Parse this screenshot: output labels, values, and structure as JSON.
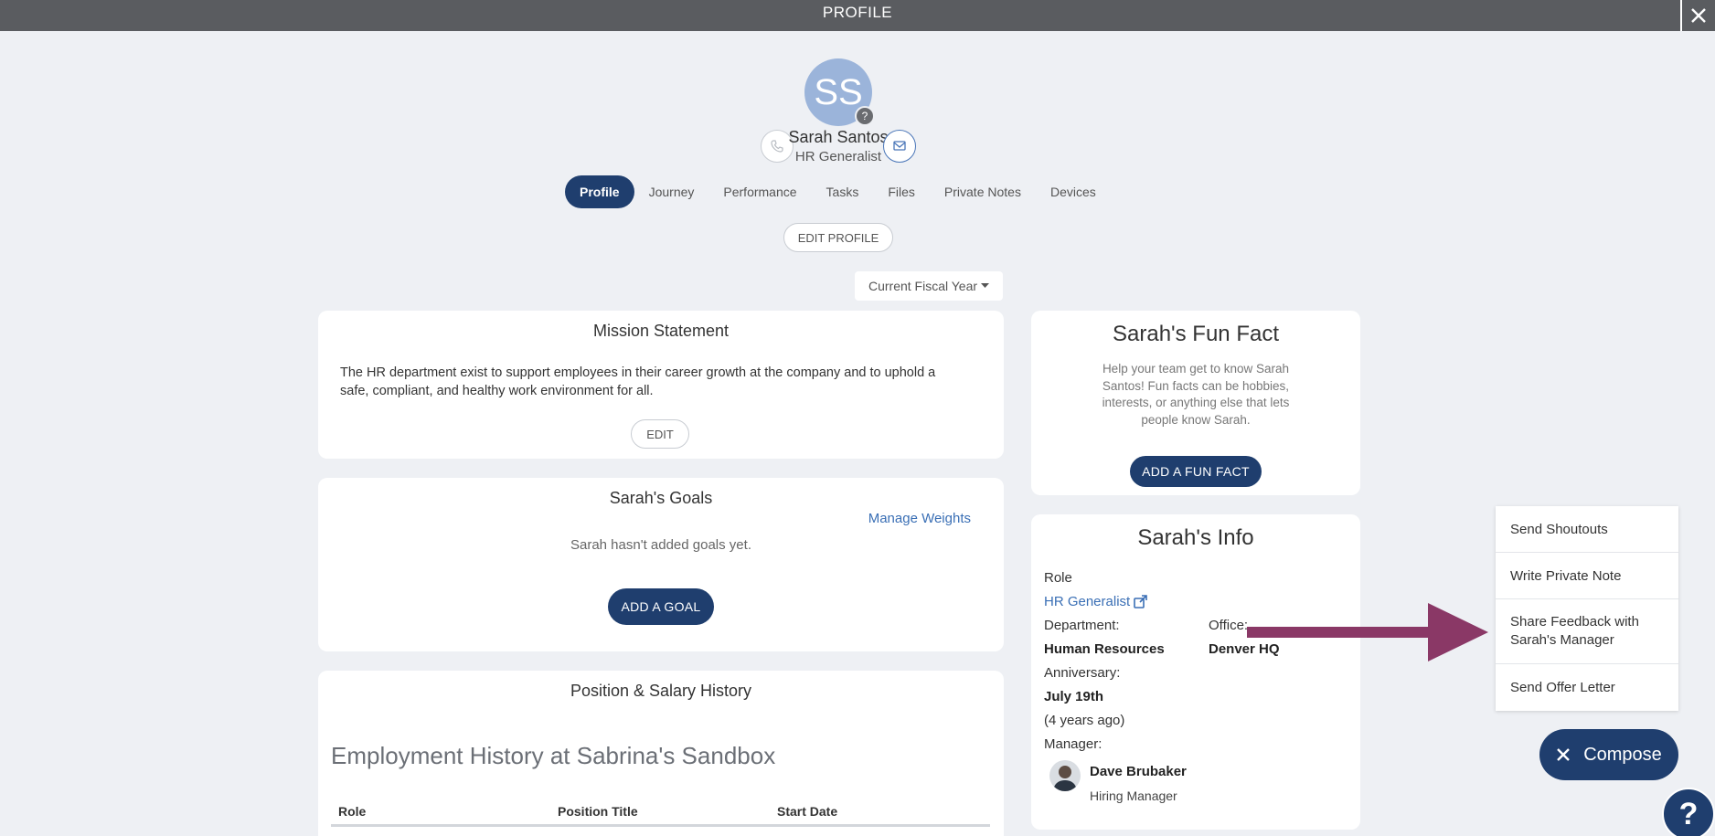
{
  "window": {
    "title": "PROFILE"
  },
  "profile": {
    "initials": "SS",
    "help_badge": "?",
    "name": "Sarah Santos",
    "role": "HR Generalist"
  },
  "tabs": [
    {
      "label": "Profile",
      "active": true
    },
    {
      "label": "Journey"
    },
    {
      "label": "Performance"
    },
    {
      "label": "Tasks"
    },
    {
      "label": "Files"
    },
    {
      "label": "Private Notes"
    },
    {
      "label": "Devices"
    }
  ],
  "edit_profile_label": "EDIT PROFILE",
  "fiscal_select": {
    "value": "Current Fiscal Year"
  },
  "mission": {
    "title": "Mission Statement",
    "text": "The HR department exist to support employees in their career growth at the company and to uphold a safe, compliant, and healthy work environment for all.",
    "edit_label": "EDIT"
  },
  "goals": {
    "title": "Sarah's Goals",
    "manage_weights": "Manage Weights",
    "empty_text": "Sarah hasn't added goals yet.",
    "add_label": "ADD A GOAL"
  },
  "position_history": {
    "title": "Position & Salary History",
    "heading": "Employment History at Sabrina's Sandbox",
    "columns": [
      "Role",
      "Position Title",
      "Start Date"
    ]
  },
  "fun_fact": {
    "title": "Sarah's Fun Fact",
    "description": "Help your team get to know Sarah Santos! Fun facts can be hobbies, interests, or anything else that lets people know Sarah.",
    "add_label": "ADD A FUN FACT"
  },
  "info": {
    "title": "Sarah's Info",
    "role_label": "Role",
    "role_link": "HR Generalist",
    "department_label": "Department:",
    "department_value": "Human Resources",
    "office_label": "Office:",
    "office_value": "Denver HQ",
    "anniversary_label": "Anniversary:",
    "anniversary_value": "July 19th",
    "anniversary_ago": "(4 years ago)",
    "manager_label": "Manager:",
    "manager_name": "Dave Brubaker",
    "manager_title": "Hiring Manager"
  },
  "compose_menu": {
    "items": [
      "Send Shoutouts",
      "Write Private Note",
      "Share Feedback with Sarah's Manager",
      "Send Offer Letter"
    ]
  },
  "compose_label": "Compose",
  "help_label": "?",
  "colors": {
    "primary": "#1f3e6e",
    "avatar": "#9bb4da",
    "arrow": "#8a3866",
    "link": "#3a6fb5"
  }
}
